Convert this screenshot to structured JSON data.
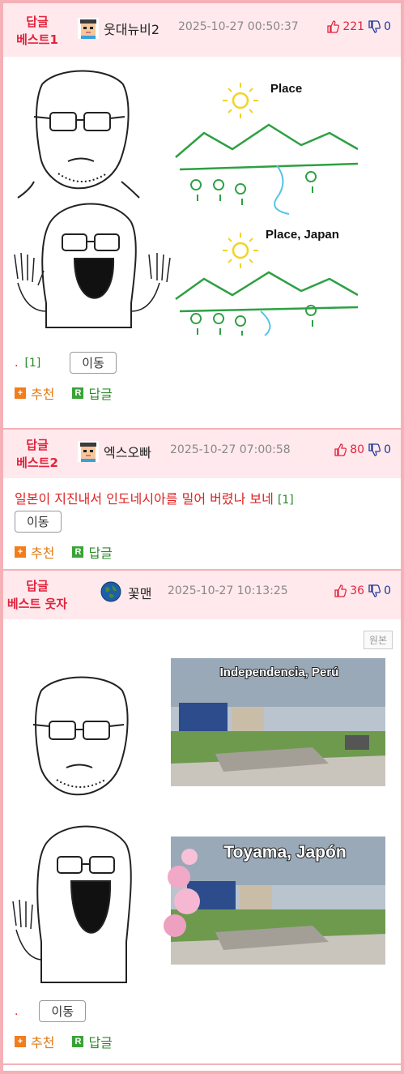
{
  "comments": [
    {
      "badge_line1": "답글",
      "badge_line2": "베스트1",
      "nick": "웃대뉴비2",
      "date": "2025-10-27 00:50:37",
      "up": "221",
      "down": "0",
      "image_labels": [
        "Place",
        "Place, Japan"
      ],
      "reply_count": "[1]",
      "move_label": "이동",
      "recommend_label": "추천",
      "reply_label": "답글"
    },
    {
      "badge_line1": "답글",
      "badge_line2": "베스트2",
      "nick": "엑스오빠",
      "date": "2025-10-27 07:00:58",
      "up": "80",
      "down": "0",
      "text": "일본이 지진내서 인도네시아를 밀어 버렸나 보네",
      "reply_count": "[1]",
      "move_label": "이동",
      "recommend_label": "추천",
      "reply_label": "답글"
    },
    {
      "badge_line1": "답글",
      "badge_line2": "베스트 웃자",
      "nick": "꽃맨",
      "date": "2025-10-27 10:13:25",
      "up": "36",
      "down": "0",
      "original_label": "원본",
      "image_labels": [
        "Independencia, Perú",
        "Toyama, Japón"
      ],
      "move_label": "이동",
      "recommend_label": "추천",
      "reply_label": "답글"
    }
  ],
  "colors": {
    "accent": "#e2233d",
    "header_bg": "#ffe9ec",
    "border": "#f5b1b6",
    "recommend": "#f27d1c",
    "reply": "#3aa337"
  },
  "icons": [
    "avatar-pixel-icon",
    "thumbs-up-icon",
    "thumbs-down-icon",
    "plus-icon",
    "reply-r-icon",
    "globe-avatar-icon"
  ]
}
